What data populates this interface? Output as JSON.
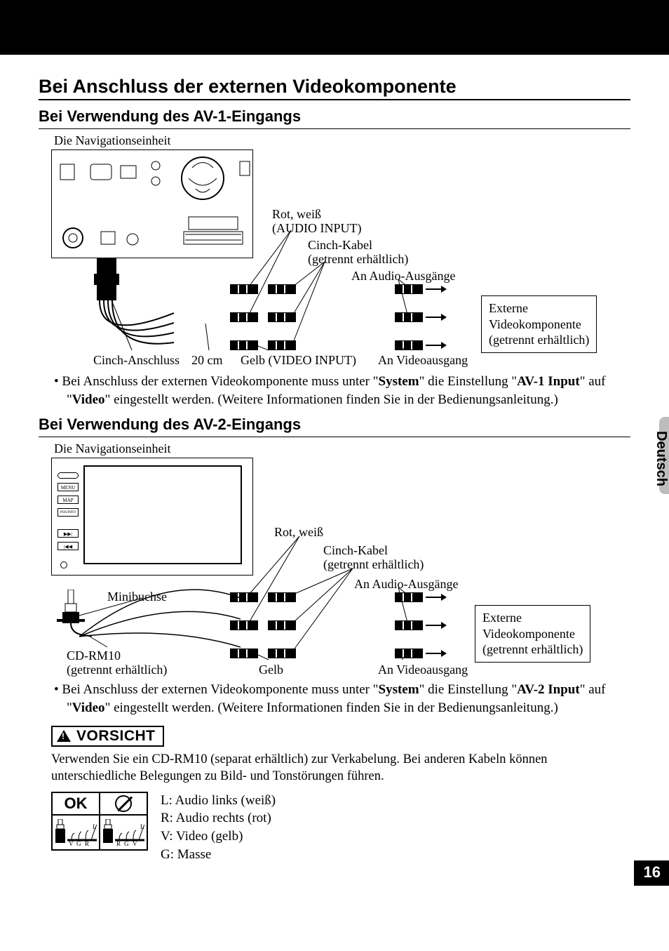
{
  "language_tab": "Deutsch",
  "page_number": "16",
  "h1": "Bei Anschluss der externen Videokomponente",
  "section1": {
    "heading": "Bei Verwendung des AV-1-Eingangs",
    "nav_unit_label": "Die Navigationseinheit",
    "labels": {
      "red_white": "Rot, weiß",
      "audio_input": "(AUDIO INPUT)",
      "cinch_cable": "Cinch-Kabel",
      "sold_sep": "(getrennt erhältlich)",
      "to_audio_out": "An Audio-Ausgänge",
      "cinch_conn": "Cinch-Anschluss",
      "twenty_cm": "20 cm",
      "yellow_video": "Gelb (VIDEO INPUT)",
      "to_video_out": "An Videoausgang"
    },
    "ext_box": {
      "line1": "Externe",
      "line2": "Videokomponente",
      "line3": "(getrennt erhältlich)"
    },
    "note_pre": "Bei Anschluss der externen Videokomponente muss unter \"",
    "note_b1": "System",
    "note_mid1": "\" die Einstellung \"",
    "note_b2": "AV-1 Input",
    "note_mid2": "\" auf \"",
    "note_b3": "Video",
    "note_post": "\" eingestellt werden. (Weitere Informationen finden Sie in der Bedienungsanleitung.)"
  },
  "section2": {
    "heading": "Bei Verwendung des AV-2-Eingangs",
    "nav_unit_label": "Die Navigationseinheit",
    "labels": {
      "red_white": "Rot, weiß",
      "cinch_cable": "Cinch-Kabel",
      "sold_sep": "(getrennt erhältlich)",
      "to_audio_out": "An Audio-Ausgänge",
      "minijack": "Minibuchse",
      "cd_rm10": "CD-RM10",
      "cd_rm10_sep": "(getrennt erhältlich)",
      "yellow": "Gelb",
      "to_video_out": "An Videoausgang"
    },
    "ext_box": {
      "line1": "Externe",
      "line2": "Videokomponente",
      "line3": "(getrennt erhältlich)"
    },
    "note_pre": "Bei Anschluss der externen Videokomponente muss unter \"",
    "note_b1": "System",
    "note_mid1": "\" die Einstellung \"",
    "note_b2": "AV-2 Input",
    "note_mid2": "\" auf \"",
    "note_b3": "Video",
    "note_post": "\" eingestellt werden. (Weitere Informationen finden Sie in der Bedienungsanleitung.)"
  },
  "vorsicht": {
    "title": "VORSICHT",
    "text": "Verwenden Sie ein CD-RM10 (separat erhältlich) zur Verkabelung. Bei anderen Kabeln können unterschiedliche Belegungen zu Bild- und Tonstörungen führen."
  },
  "ok_table": {
    "ok": "OK",
    "pins_ok": {
      "p1": "V",
      "p2": "G",
      "p3": "R",
      "tip": "L"
    },
    "pins_bad": {
      "p1": "R",
      "p2": "G",
      "p3": "V",
      "tip": "L"
    }
  },
  "legend": {
    "l": "L: Audio links (weiß)",
    "r": "R: Audio rechts (rot)",
    "v": "V: Video (gelb)",
    "g": "G: Masse"
  }
}
